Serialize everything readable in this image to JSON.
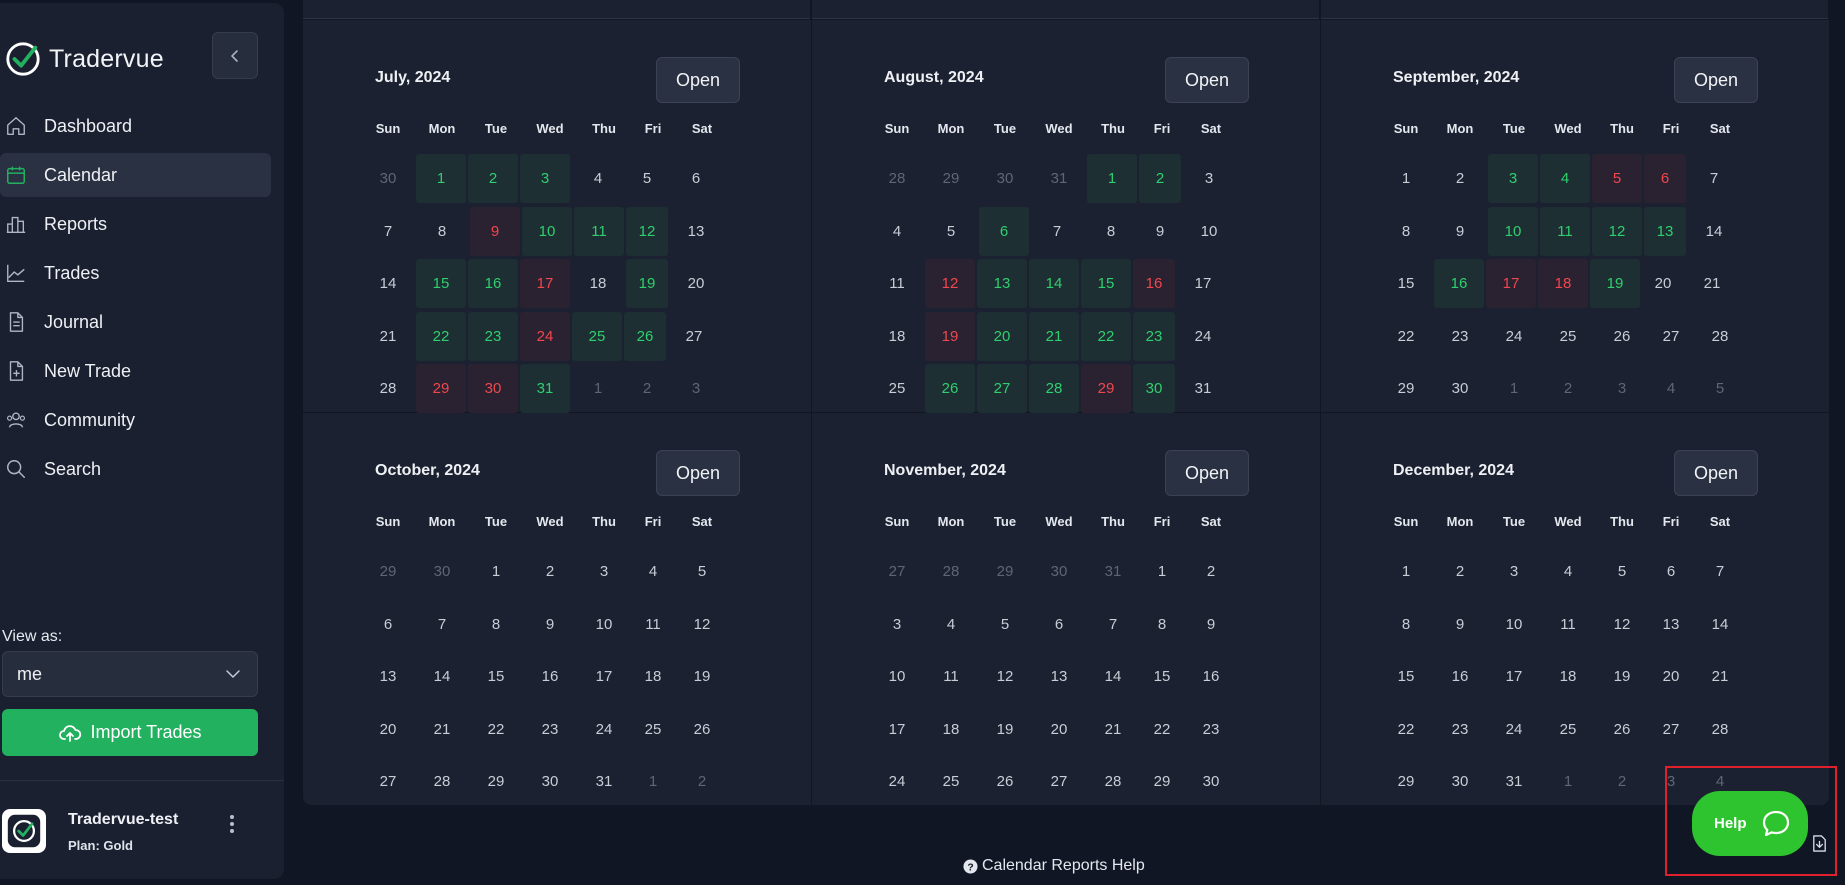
{
  "app": {
    "name": "Tradervue"
  },
  "colors": {
    "accent": "#22b15f",
    "win_text": "#2fcf6e",
    "loss_text": "#f0474f",
    "help_bubble": "#2ec42f"
  },
  "sidebar": {
    "items": [
      {
        "label": "Dashboard",
        "icon": "home-icon",
        "active": false
      },
      {
        "label": "Calendar",
        "icon": "calendar-icon",
        "active": true
      },
      {
        "label": "Reports",
        "icon": "bar-chart-icon",
        "active": false
      },
      {
        "label": "Trades",
        "icon": "line-chart-icon",
        "active": false
      },
      {
        "label": "Journal",
        "icon": "document-icon",
        "active": false
      },
      {
        "label": "New Trade",
        "icon": "document-add-icon",
        "active": false
      },
      {
        "label": "Community",
        "icon": "users-icon",
        "active": false
      },
      {
        "label": "Search",
        "icon": "search-icon",
        "active": false
      }
    ],
    "view_as_label": "View as:",
    "view_as_value": "me",
    "import_label": "Import Trades",
    "user": {
      "name": "Tradervue-test",
      "plan": "Plan: Gold"
    }
  },
  "calendar": {
    "open_label": "Open",
    "weekdays": [
      "Sun",
      "Mon",
      "Tue",
      "Wed",
      "Thu",
      "Fri",
      "Sat"
    ],
    "months": [
      {
        "title": "July, 2024",
        "weeks": [
          [
            {
              "d": "30",
              "s": "out"
            },
            {
              "d": "1",
              "s": "win"
            },
            {
              "d": "2",
              "s": "win"
            },
            {
              "d": "3",
              "s": "win"
            },
            {
              "d": "4",
              "s": ""
            },
            {
              "d": "5",
              "s": ""
            },
            {
              "d": "6",
              "s": ""
            }
          ],
          [
            {
              "d": "7",
              "s": ""
            },
            {
              "d": "8",
              "s": ""
            },
            {
              "d": "9",
              "s": "loss"
            },
            {
              "d": "10",
              "s": "win"
            },
            {
              "d": "11",
              "s": "win"
            },
            {
              "d": "12",
              "s": "win"
            },
            {
              "d": "13",
              "s": ""
            }
          ],
          [
            {
              "d": "14",
              "s": ""
            },
            {
              "d": "15",
              "s": "win"
            },
            {
              "d": "16",
              "s": "win"
            },
            {
              "d": "17",
              "s": "loss"
            },
            {
              "d": "18",
              "s": ""
            },
            {
              "d": "19",
              "s": "win"
            },
            {
              "d": "20",
              "s": ""
            }
          ],
          [
            {
              "d": "21",
              "s": ""
            },
            {
              "d": "22",
              "s": "win"
            },
            {
              "d": "23",
              "s": "win"
            },
            {
              "d": "24",
              "s": "loss"
            },
            {
              "d": "25",
              "s": "win"
            },
            {
              "d": "26",
              "s": "win"
            },
            {
              "d": "27",
              "s": ""
            }
          ],
          [
            {
              "d": "28",
              "s": ""
            },
            {
              "d": "29",
              "s": "loss"
            },
            {
              "d": "30",
              "s": "loss"
            },
            {
              "d": "31",
              "s": "win"
            },
            {
              "d": "1",
              "s": "out"
            },
            {
              "d": "2",
              "s": "out"
            },
            {
              "d": "3",
              "s": "out"
            }
          ]
        ]
      },
      {
        "title": "August, 2024",
        "weeks": [
          [
            {
              "d": "28",
              "s": "out"
            },
            {
              "d": "29",
              "s": "out"
            },
            {
              "d": "30",
              "s": "out"
            },
            {
              "d": "31",
              "s": "out"
            },
            {
              "d": "1",
              "s": "win"
            },
            {
              "d": "2",
              "s": "win"
            },
            {
              "d": "3",
              "s": ""
            }
          ],
          [
            {
              "d": "4",
              "s": ""
            },
            {
              "d": "5",
              "s": ""
            },
            {
              "d": "6",
              "s": "win"
            },
            {
              "d": "7",
              "s": ""
            },
            {
              "d": "8",
              "s": ""
            },
            {
              "d": "9",
              "s": ""
            },
            {
              "d": "10",
              "s": ""
            }
          ],
          [
            {
              "d": "11",
              "s": ""
            },
            {
              "d": "12",
              "s": "loss"
            },
            {
              "d": "13",
              "s": "win"
            },
            {
              "d": "14",
              "s": "win"
            },
            {
              "d": "15",
              "s": "win"
            },
            {
              "d": "16",
              "s": "loss"
            },
            {
              "d": "17",
              "s": ""
            }
          ],
          [
            {
              "d": "18",
              "s": ""
            },
            {
              "d": "19",
              "s": "loss"
            },
            {
              "d": "20",
              "s": "win"
            },
            {
              "d": "21",
              "s": "win"
            },
            {
              "d": "22",
              "s": "win"
            },
            {
              "d": "23",
              "s": "win"
            },
            {
              "d": "24",
              "s": ""
            }
          ],
          [
            {
              "d": "25",
              "s": ""
            },
            {
              "d": "26",
              "s": "win"
            },
            {
              "d": "27",
              "s": "win"
            },
            {
              "d": "28",
              "s": "win"
            },
            {
              "d": "29",
              "s": "loss"
            },
            {
              "d": "30",
              "s": "win"
            },
            {
              "d": "31",
              "s": ""
            }
          ]
        ]
      },
      {
        "title": "September, 2024",
        "weeks": [
          [
            {
              "d": "1",
              "s": ""
            },
            {
              "d": "2",
              "s": ""
            },
            {
              "d": "3",
              "s": "win"
            },
            {
              "d": "4",
              "s": "win"
            },
            {
              "d": "5",
              "s": "loss"
            },
            {
              "d": "6",
              "s": "loss"
            },
            {
              "d": "7",
              "s": ""
            }
          ],
          [
            {
              "d": "8",
              "s": ""
            },
            {
              "d": "9",
              "s": ""
            },
            {
              "d": "10",
              "s": "win"
            },
            {
              "d": "11",
              "s": "win"
            },
            {
              "d": "12",
              "s": "win"
            },
            {
              "d": "13",
              "s": "win"
            },
            {
              "d": "14",
              "s": ""
            }
          ],
          [
            {
              "d": "15",
              "s": ""
            },
            {
              "d": "16",
              "s": "win"
            },
            {
              "d": "17",
              "s": "loss"
            },
            {
              "d": "18",
              "s": "loss"
            },
            {
              "d": "19",
              "s": "win"
            },
            {
              "d": "20",
              "s": ""
            },
            {
              "d": "21",
              "s": ""
            }
          ],
          [
            {
              "d": "22",
              "s": ""
            },
            {
              "d": "23",
              "s": ""
            },
            {
              "d": "24",
              "s": ""
            },
            {
              "d": "25",
              "s": ""
            },
            {
              "d": "26",
              "s": ""
            },
            {
              "d": "27",
              "s": ""
            },
            {
              "d": "28",
              "s": ""
            }
          ],
          [
            {
              "d": "29",
              "s": ""
            },
            {
              "d": "30",
              "s": ""
            },
            {
              "d": "1",
              "s": "out"
            },
            {
              "d": "2",
              "s": "out"
            },
            {
              "d": "3",
              "s": "out"
            },
            {
              "d": "4",
              "s": "out"
            },
            {
              "d": "5",
              "s": "out"
            }
          ]
        ]
      },
      {
        "title": "October, 2024",
        "weeks": [
          [
            {
              "d": "29",
              "s": "out"
            },
            {
              "d": "30",
              "s": "out"
            },
            {
              "d": "1",
              "s": ""
            },
            {
              "d": "2",
              "s": ""
            },
            {
              "d": "3",
              "s": ""
            },
            {
              "d": "4",
              "s": ""
            },
            {
              "d": "5",
              "s": ""
            }
          ],
          [
            {
              "d": "6",
              "s": ""
            },
            {
              "d": "7",
              "s": ""
            },
            {
              "d": "8",
              "s": ""
            },
            {
              "d": "9",
              "s": ""
            },
            {
              "d": "10",
              "s": ""
            },
            {
              "d": "11",
              "s": ""
            },
            {
              "d": "12",
              "s": ""
            }
          ],
          [
            {
              "d": "13",
              "s": ""
            },
            {
              "d": "14",
              "s": ""
            },
            {
              "d": "15",
              "s": ""
            },
            {
              "d": "16",
              "s": ""
            },
            {
              "d": "17",
              "s": ""
            },
            {
              "d": "18",
              "s": ""
            },
            {
              "d": "19",
              "s": ""
            }
          ],
          [
            {
              "d": "20",
              "s": ""
            },
            {
              "d": "21",
              "s": ""
            },
            {
              "d": "22",
              "s": ""
            },
            {
              "d": "23",
              "s": ""
            },
            {
              "d": "24",
              "s": ""
            },
            {
              "d": "25",
              "s": ""
            },
            {
              "d": "26",
              "s": ""
            }
          ],
          [
            {
              "d": "27",
              "s": ""
            },
            {
              "d": "28",
              "s": ""
            },
            {
              "d": "29",
              "s": ""
            },
            {
              "d": "30",
              "s": ""
            },
            {
              "d": "31",
              "s": ""
            },
            {
              "d": "1",
              "s": "out"
            },
            {
              "d": "2",
              "s": "out"
            }
          ]
        ]
      },
      {
        "title": "November, 2024",
        "weeks": [
          [
            {
              "d": "27",
              "s": "out"
            },
            {
              "d": "28",
              "s": "out"
            },
            {
              "d": "29",
              "s": "out"
            },
            {
              "d": "30",
              "s": "out"
            },
            {
              "d": "31",
              "s": "out"
            },
            {
              "d": "1",
              "s": ""
            },
            {
              "d": "2",
              "s": ""
            }
          ],
          [
            {
              "d": "3",
              "s": ""
            },
            {
              "d": "4",
              "s": ""
            },
            {
              "d": "5",
              "s": ""
            },
            {
              "d": "6",
              "s": ""
            },
            {
              "d": "7",
              "s": ""
            },
            {
              "d": "8",
              "s": ""
            },
            {
              "d": "9",
              "s": ""
            }
          ],
          [
            {
              "d": "10",
              "s": ""
            },
            {
              "d": "11",
              "s": ""
            },
            {
              "d": "12",
              "s": ""
            },
            {
              "d": "13",
              "s": ""
            },
            {
              "d": "14",
              "s": ""
            },
            {
              "d": "15",
              "s": ""
            },
            {
              "d": "16",
              "s": ""
            }
          ],
          [
            {
              "d": "17",
              "s": ""
            },
            {
              "d": "18",
              "s": ""
            },
            {
              "d": "19",
              "s": ""
            },
            {
              "d": "20",
              "s": ""
            },
            {
              "d": "21",
              "s": ""
            },
            {
              "d": "22",
              "s": ""
            },
            {
              "d": "23",
              "s": ""
            }
          ],
          [
            {
              "d": "24",
              "s": ""
            },
            {
              "d": "25",
              "s": ""
            },
            {
              "d": "26",
              "s": ""
            },
            {
              "d": "27",
              "s": ""
            },
            {
              "d": "28",
              "s": ""
            },
            {
              "d": "29",
              "s": ""
            },
            {
              "d": "30",
              "s": ""
            }
          ]
        ]
      },
      {
        "title": "December, 2024",
        "weeks": [
          [
            {
              "d": "1",
              "s": ""
            },
            {
              "d": "2",
              "s": ""
            },
            {
              "d": "3",
              "s": ""
            },
            {
              "d": "4",
              "s": ""
            },
            {
              "d": "5",
              "s": ""
            },
            {
              "d": "6",
              "s": ""
            },
            {
              "d": "7",
              "s": ""
            }
          ],
          [
            {
              "d": "8",
              "s": ""
            },
            {
              "d": "9",
              "s": ""
            },
            {
              "d": "10",
              "s": ""
            },
            {
              "d": "11",
              "s": ""
            },
            {
              "d": "12",
              "s": ""
            },
            {
              "d": "13",
              "s": ""
            },
            {
              "d": "14",
              "s": ""
            }
          ],
          [
            {
              "d": "15",
              "s": ""
            },
            {
              "d": "16",
              "s": ""
            },
            {
              "d": "17",
              "s": ""
            },
            {
              "d": "18",
              "s": ""
            },
            {
              "d": "19",
              "s": ""
            },
            {
              "d": "20",
              "s": ""
            },
            {
              "d": "21",
              "s": ""
            }
          ],
          [
            {
              "d": "22",
              "s": ""
            },
            {
              "d": "23",
              "s": ""
            },
            {
              "d": "24",
              "s": ""
            },
            {
              "d": "25",
              "s": ""
            },
            {
              "d": "26",
              "s": ""
            },
            {
              "d": "27",
              "s": ""
            },
            {
              "d": "28",
              "s": ""
            }
          ],
          [
            {
              "d": "29",
              "s": ""
            },
            {
              "d": "30",
              "s": ""
            },
            {
              "d": "31",
              "s": ""
            },
            {
              "d": "1",
              "s": "out"
            },
            {
              "d": "2",
              "s": "out"
            },
            {
              "d": "3",
              "s": "out"
            },
            {
              "d": "4",
              "s": "out"
            }
          ]
        ]
      }
    ]
  },
  "footer": {
    "help_link": "Calendar Reports Help"
  },
  "help_widget": {
    "label": "Help"
  }
}
